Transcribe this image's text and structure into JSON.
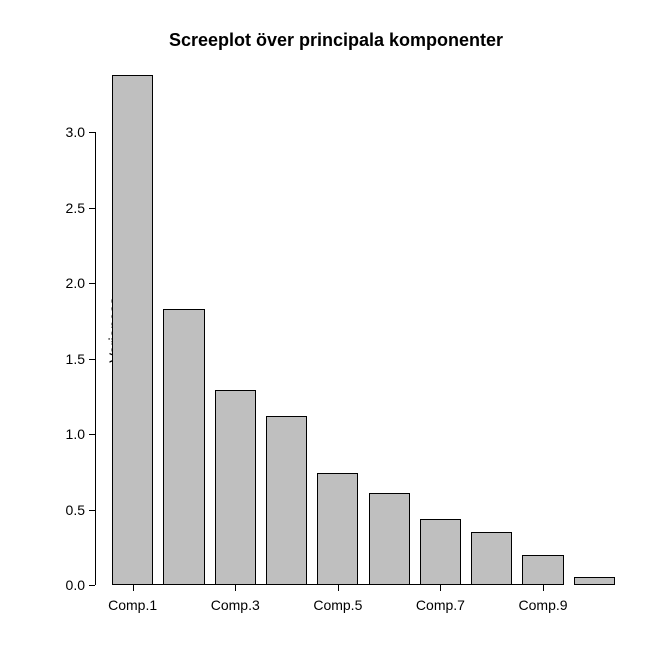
{
  "chart_data": {
    "type": "bar",
    "title": "Screeplot över principala komponenter",
    "ylabel": "Variances",
    "xlabel": "",
    "categories": [
      "Comp.1",
      "Comp.2",
      "Comp.3",
      "Comp.4",
      "Comp.5",
      "Comp.6",
      "Comp.7",
      "Comp.8",
      "Comp.9",
      "Comp.10"
    ],
    "values": [
      3.38,
      1.83,
      1.29,
      1.12,
      0.74,
      0.61,
      0.44,
      0.35,
      0.2,
      0.05
    ],
    "ylim": [
      0,
      3.38
    ],
    "y_ticks": [
      0.0,
      0.5,
      1.0,
      1.5,
      2.0,
      2.5,
      3.0
    ],
    "x_tick_labels": [
      "Comp.1",
      "Comp.3",
      "Comp.5",
      "Comp.7",
      "Comp.9"
    ],
    "x_tick_positions_index": [
      0,
      2,
      4,
      6,
      8
    ]
  }
}
